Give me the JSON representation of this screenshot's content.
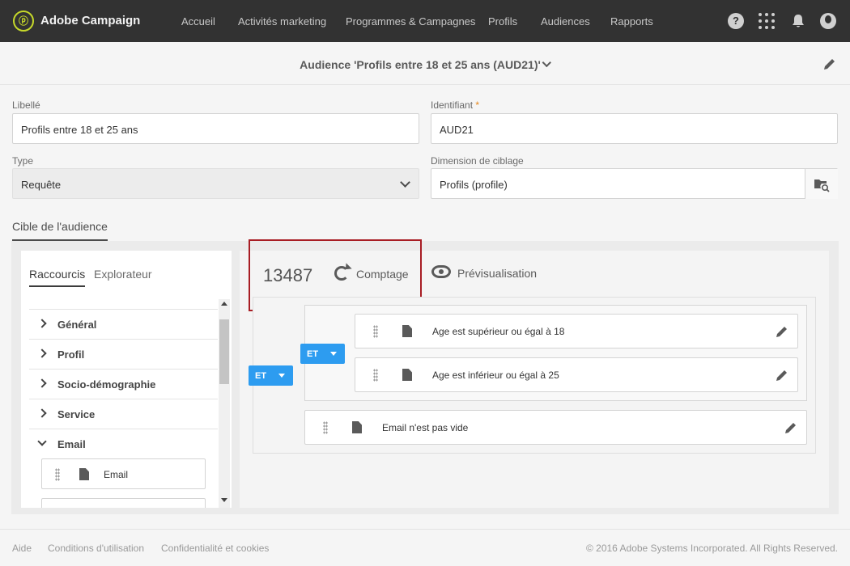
{
  "app": {
    "brand": "Adobe Campaign",
    "nav": [
      "Accueil",
      "Activités marketing",
      "Programmes & Campagnes",
      "Profils",
      "Audiences",
      "Rapports"
    ],
    "help_glyph": "?",
    "icons": [
      "help-icon",
      "apps-grid-icon",
      "bell-icon",
      "avatar"
    ]
  },
  "header": {
    "title": "Audience 'Profils entre 18 et 25 ans (AUD21)'"
  },
  "form": {
    "libelle_label": "Libellé",
    "libelle_value": "Profils entre 18 et 25 ans",
    "identifiant_label": "Identifiant",
    "identifiant_required": "*",
    "identifiant_value": "AUD21",
    "type_label": "Type",
    "type_value": "Requête",
    "dimension_label": "Dimension de ciblage",
    "dimension_value": "Profils (profile)"
  },
  "section": {
    "tab": "Cible de l'audience"
  },
  "palette": {
    "tabs": [
      "Raccourcis",
      "Explorateur"
    ],
    "categories": [
      "Général",
      "Profil",
      "Socio-démographie",
      "Service",
      "Email"
    ],
    "email_field": "Email"
  },
  "query": {
    "count": "13487",
    "count_button": "Comptage",
    "preview_button": "Prévisualisation",
    "outer_operator": "ET",
    "inner_operator": "ET",
    "conditions": [
      "Age est supérieur ou égal à 18",
      "Age est inférieur ou égal à 25",
      "Email n'est pas vide"
    ]
  },
  "footer": {
    "links": [
      "Aide",
      "Conditions d'utilisation",
      "Confidentialité et cookies"
    ],
    "copyright": "© 2016 Adobe Systems Incorporated. All Rights Reserved."
  },
  "colors": {
    "topbar": "#323232",
    "logo": "#c6d82a",
    "operator": "#2d9cf0",
    "highlight": "#a81d24",
    "required": "#e68619"
  }
}
